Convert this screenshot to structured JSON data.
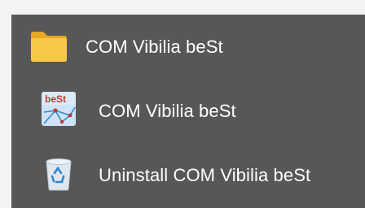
{
  "start_menu_group": {
    "folder": {
      "label": "COM Vibilia beSt",
      "icon": "folder-icon",
      "color": "#f3c03c"
    },
    "items": [
      {
        "label": "COM Vibilia beSt",
        "icon": "best-app-icon",
        "icon_text": "beSt",
        "icon_text_color": "#c0392b"
      },
      {
        "label": "Uninstall COM Vibilia beSt",
        "icon": "recycle-bin-icon"
      }
    ]
  },
  "colors": {
    "panel_background": "#575757",
    "page_background": "#f3f3f3",
    "text": "#ffffff"
  }
}
